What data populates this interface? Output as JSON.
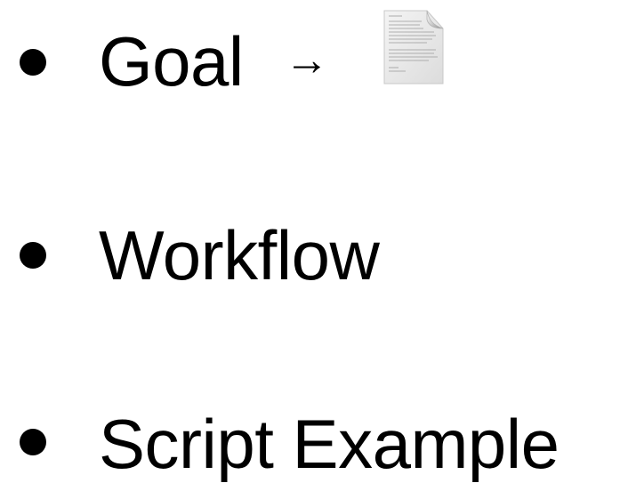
{
  "bullets": [
    {
      "label": "Goal",
      "arrow": "→",
      "icon": "document-icon"
    },
    {
      "label": "Workflow"
    },
    {
      "label": "Script Example"
    }
  ]
}
